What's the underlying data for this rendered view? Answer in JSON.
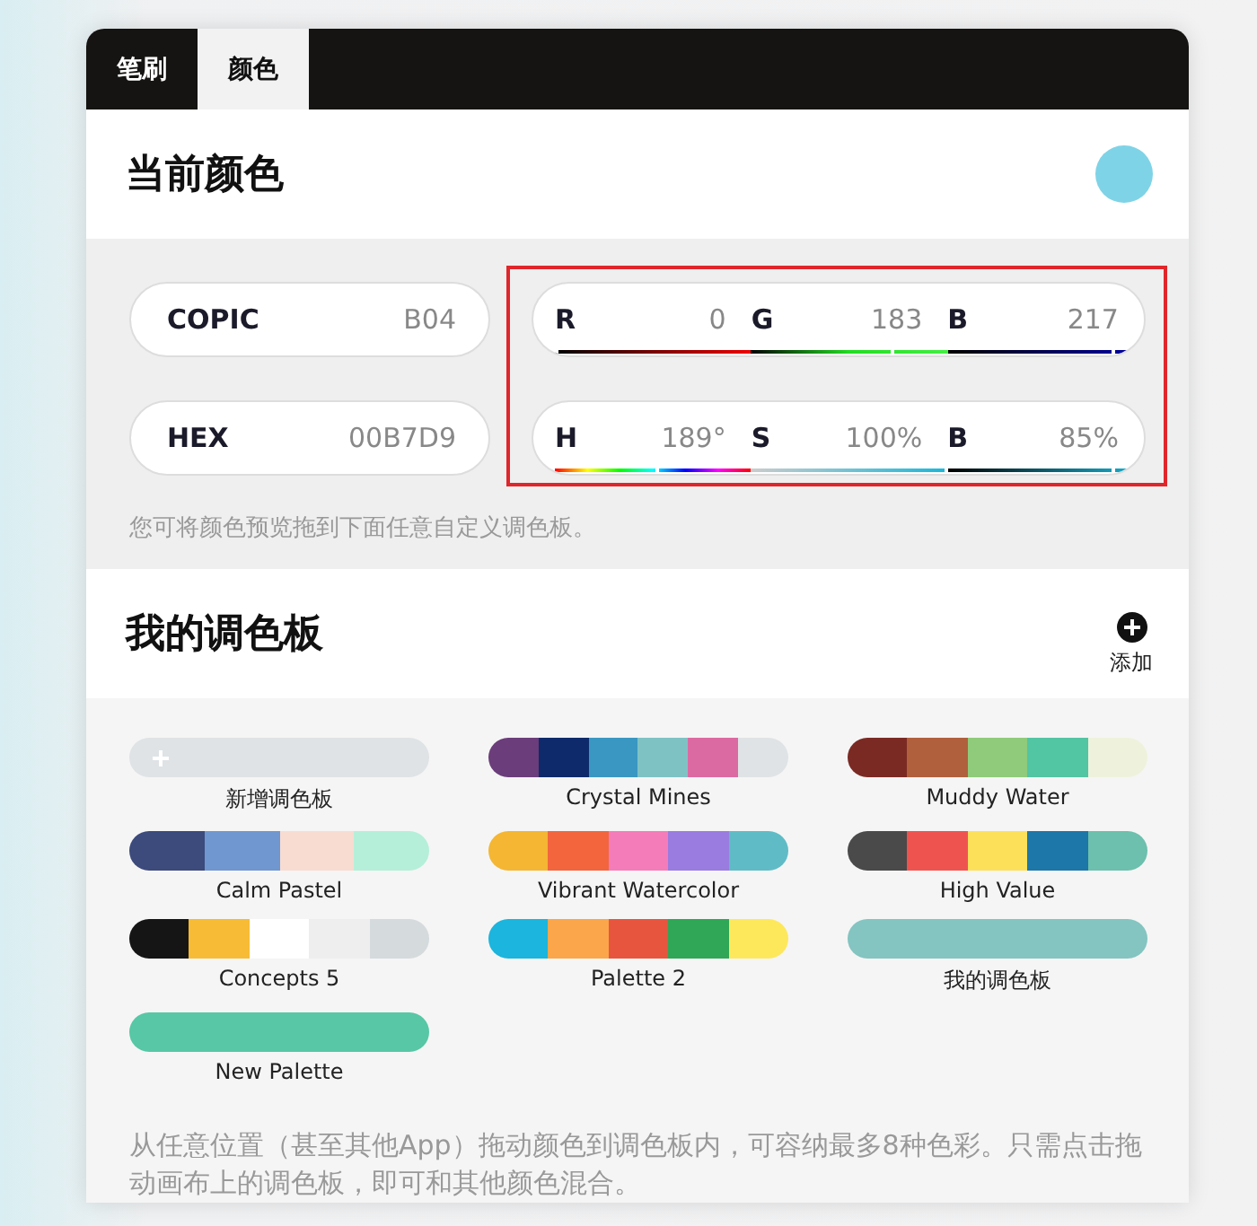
{
  "tabs": [
    {
      "label": "笔刷",
      "selected": false
    },
    {
      "label": "颜色",
      "selected": true
    }
  ],
  "current_color": {
    "title": "当前颜色",
    "color": "#7fd3e6"
  },
  "codes": [
    {
      "label": "COPIC",
      "value": "B04"
    },
    {
      "label": "HEX",
      "value": "00B7D9"
    }
  ],
  "channels_highlighted": true,
  "channel_groups": [
    {
      "channels": [
        {
          "kind": "red",
          "label": "R",
          "value": "0",
          "level": 0
        },
        {
          "kind": "green",
          "label": "G",
          "value": "183",
          "level": 0.72
        },
        {
          "kind": "blue",
          "label": "B",
          "value": "217",
          "level": 0.85
        }
      ]
    },
    {
      "channels": [
        {
          "kind": "hue",
          "label": "H",
          "value": "189°",
          "level": 0.525
        },
        {
          "kind": "saturation",
          "label": "S",
          "value": "100%",
          "level": 1
        },
        {
          "kind": "brightness",
          "label": "B",
          "value": "85%",
          "level": 0.85
        }
      ]
    }
  ],
  "hint": "您可将颜色预览拖到下面任意自定义调色板。",
  "palettes_section": {
    "title": "我的调色板",
    "add_label": "添加"
  },
  "palettes": [
    {
      "name": "新增调色板",
      "kind": "new",
      "colors": [
        {
          "color": "#dfe3e6"
        }
      ]
    },
    {
      "name": "Crystal Mines",
      "kind": "palette",
      "colors": [
        {
          "color": "#6b3d7a"
        },
        {
          "color": "#0e2a6b"
        },
        {
          "color": "#3a97c2"
        },
        {
          "color": "#7fc2c4"
        },
        {
          "color": "#dc6aa2"
        },
        {
          "color": "#dfe3e6"
        }
      ]
    },
    {
      "name": "Muddy Water",
      "kind": "palette",
      "colors": [
        {
          "color": "#7b2a23"
        },
        {
          "color": "#b0603d"
        },
        {
          "color": "#8fcb7b"
        },
        {
          "color": "#52c5a2"
        },
        {
          "color": "#eef2dc"
        }
      ]
    },
    {
      "name": "Calm Pastel",
      "kind": "palette",
      "colors": [
        {
          "color": "#3c4a7c"
        },
        {
          "color": "#7097cf"
        },
        {
          "color": "#f8dcd1"
        },
        {
          "color": "#b5efd9"
        }
      ]
    },
    {
      "name": "Vibrant Watercolor",
      "kind": "palette",
      "colors": [
        {
          "color": "#f4b633"
        },
        {
          "color": "#f2653d"
        },
        {
          "color": "#f47cb8"
        },
        {
          "color": "#9a7be0"
        },
        {
          "color": "#5fbcc6"
        }
      ]
    },
    {
      "name": "High Value",
      "kind": "palette",
      "colors": [
        {
          "color": "#4a4a4a"
        },
        {
          "color": "#ef5350"
        },
        {
          "color": "#fde05a"
        },
        {
          "color": "#1d77a8"
        },
        {
          "color": "#6cc0ad"
        }
      ]
    },
    {
      "name": "Concepts 5",
      "kind": "palette",
      "colors": [
        {
          "color": "#151515"
        },
        {
          "color": "#f7bb35"
        },
        {
          "color": "#ffffff"
        },
        {
          "color": "#eeeeee"
        },
        {
          "color": "#d5dadd"
        }
      ]
    },
    {
      "name": "Palette 2",
      "kind": "palette",
      "colors": [
        {
          "color": "#1bb5dd"
        },
        {
          "color": "#fba64b"
        },
        {
          "color": "#e8553f"
        },
        {
          "color": "#2fa756"
        },
        {
          "color": "#fde85c"
        }
      ]
    },
    {
      "name": "我的调色板",
      "kind": "palette",
      "colors": [
        {
          "color": "#84c4c1"
        }
      ]
    },
    {
      "name": "New Palette",
      "kind": "palette",
      "colors": [
        {
          "color": "#57c7a5"
        }
      ]
    }
  ],
  "footer": "从任意位置（甚至其他App）拖动颜色到调色板内，可容纳最多8种色彩。只需点击拖动画布上的调色板，即可和其他颜色混合。"
}
